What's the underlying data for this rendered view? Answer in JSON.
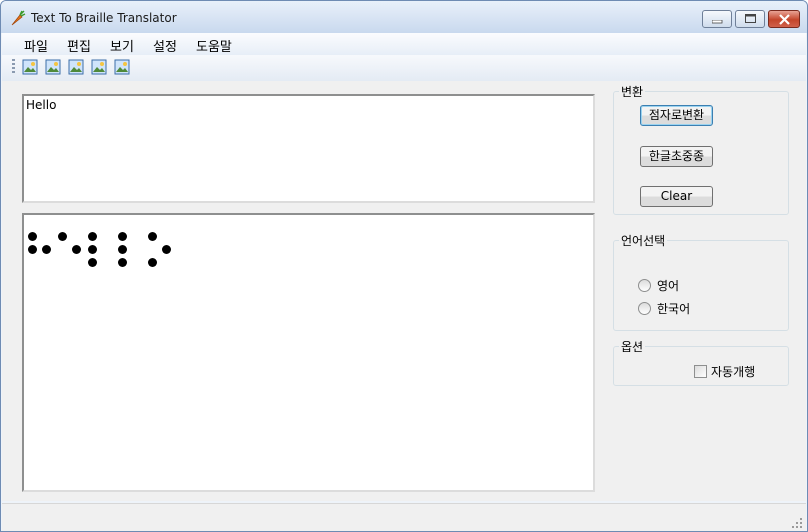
{
  "window": {
    "title": "Text To Braille Translator"
  },
  "menu": [
    "파일",
    "편집",
    "보기",
    "설정",
    "도움말"
  ],
  "toolbar": {
    "icon_count": 5,
    "icon": "image-icon"
  },
  "input": {
    "value": "Hello"
  },
  "output": {
    "braille_cells": [
      {
        "char": "H",
        "dots": [
          1,
          2,
          5
        ]
      },
      {
        "char": "e",
        "dots": [
          1,
          5
        ]
      },
      {
        "char": "l",
        "dots": [
          1,
          2,
          3
        ]
      },
      {
        "char": "l",
        "dots": [
          1,
          2,
          3
        ]
      },
      {
        "char": "o",
        "dots": [
          1,
          3,
          5
        ]
      }
    ]
  },
  "convert_group": {
    "title": "변환",
    "to_braille_button": "점자로변환",
    "hangul_button": "한글초중종",
    "clear_button": "Clear"
  },
  "language_group": {
    "title": "언어선택",
    "english": "영어",
    "korean": "한국어"
  },
  "option_group": {
    "title": "옵션",
    "auto_wrap": "자동개행"
  }
}
